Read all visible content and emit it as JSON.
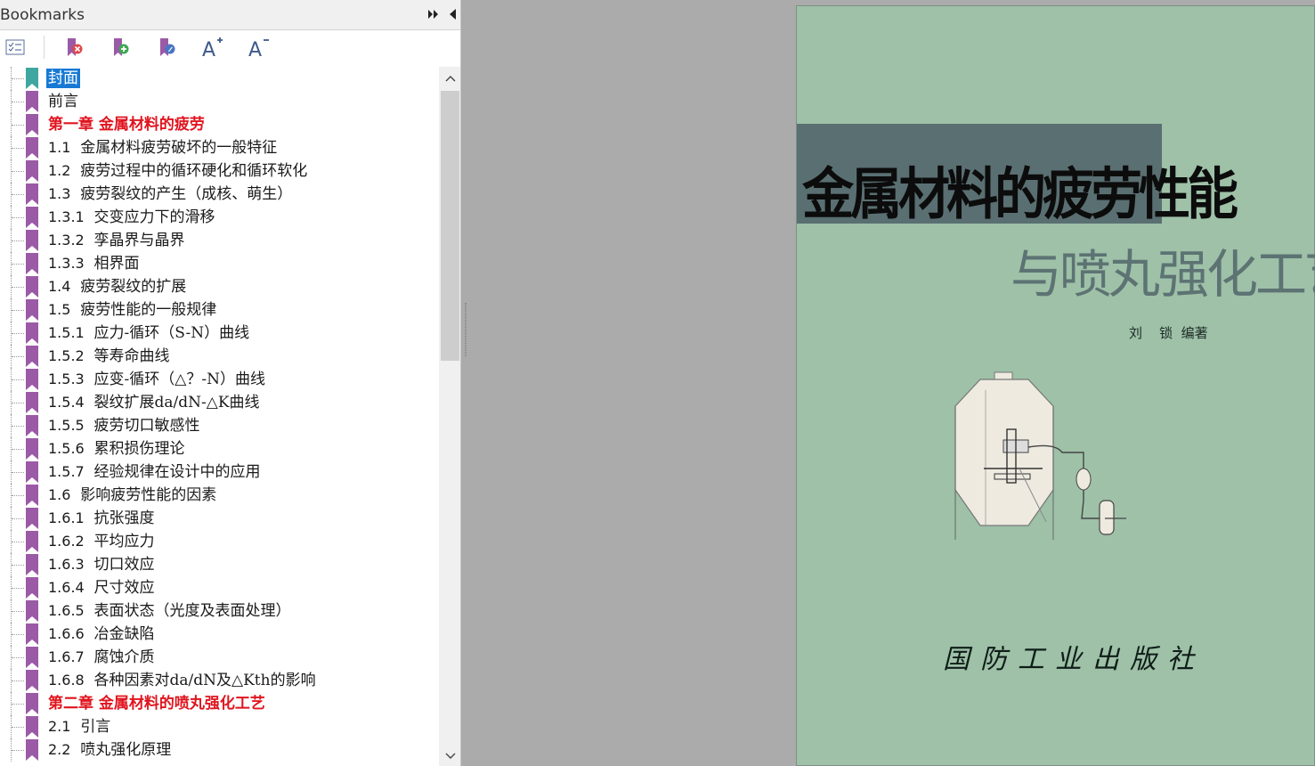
{
  "panel": {
    "title": "Bookmarks",
    "header_buttons": [
      "expand-icon",
      "collapse-panel-icon"
    ],
    "toolbar": [
      "bookmark-options-icon",
      "delete-bookmark-icon",
      "add-bookmark-icon",
      "bookmark-properties-icon",
      "increase-font-icon",
      "decrease-font-icon"
    ],
    "colors": {
      "bookmark_icon": "#9b5aa6",
      "bookmark_selected_icon": "#3fa6a0",
      "chapter_text": "#e0141e",
      "selection": "#1779d4"
    }
  },
  "bookmarks": [
    {
      "num": "",
      "text": "封面",
      "kind": "selected"
    },
    {
      "num": "",
      "text": "前言",
      "kind": "normal"
    },
    {
      "num": "",
      "text": "第一章  金属材料的疲劳",
      "kind": "chapter"
    },
    {
      "num": "1.1",
      "text": "金属材料疲劳破坏的一般特征",
      "kind": "normal"
    },
    {
      "num": "1.2",
      "text": "疲劳过程中的循环硬化和循环软化",
      "kind": "normal"
    },
    {
      "num": "1.3",
      "text": "疲劳裂纹的产生（成核、萌生）",
      "kind": "normal"
    },
    {
      "num": "1.3.1",
      "text": "交变应力下的滑移",
      "kind": "normal"
    },
    {
      "num": "1.3.2",
      "text": "孪晶界与晶界",
      "kind": "normal"
    },
    {
      "num": "1.3.3",
      "text": "相界面",
      "kind": "normal"
    },
    {
      "num": "1.4",
      "text": "疲劳裂纹的扩展",
      "kind": "normal"
    },
    {
      "num": "1.5",
      "text": "疲劳性能的一般规律",
      "kind": "normal"
    },
    {
      "num": "1.5.1",
      "text": "应力-循环（S-N）曲线",
      "kind": "normal"
    },
    {
      "num": "1.5.2",
      "text": "等寿命曲线",
      "kind": "normal"
    },
    {
      "num": "1.5.3",
      "text": "应变-循环（△？-N）曲线",
      "kind": "normal"
    },
    {
      "num": "1.5.4",
      "text": "裂纹扩展da/dN-△K曲线",
      "kind": "normal"
    },
    {
      "num": "1.5.5",
      "text": "疲劳切口敏感性",
      "kind": "normal"
    },
    {
      "num": "1.5.6",
      "text": "累积损伤理论",
      "kind": "normal"
    },
    {
      "num": "1.5.7",
      "text": "经验规律在设计中的应用",
      "kind": "normal"
    },
    {
      "num": "1.6",
      "text": "影响疲劳性能的因素",
      "kind": "normal"
    },
    {
      "num": "1.6.1",
      "text": "抗张强度",
      "kind": "normal"
    },
    {
      "num": "1.6.2",
      "text": "平均应力",
      "kind": "normal"
    },
    {
      "num": "1.6.3",
      "text": "切口效应",
      "kind": "normal"
    },
    {
      "num": "1.6.4",
      "text": "尺寸效应",
      "kind": "normal"
    },
    {
      "num": "1.6.5",
      "text": "表面状态（光度及表面处理）",
      "kind": "normal"
    },
    {
      "num": "1.6.6",
      "text": "冶金缺陷",
      "kind": "normal"
    },
    {
      "num": "1.6.7",
      "text": "腐蚀介质",
      "kind": "normal"
    },
    {
      "num": "1.6.8",
      "text": "各种因素对da/dN及△Kth的影响",
      "kind": "normal"
    },
    {
      "num": "",
      "text": "第二章  金属材料的喷丸强化工艺",
      "kind": "chapter"
    },
    {
      "num": "2.1",
      "text": "引言",
      "kind": "normal"
    },
    {
      "num": "2.2",
      "text": "喷丸强化原理",
      "kind": "normal"
    }
  ],
  "document": {
    "cover": {
      "title": "金属材料的疲劳性能",
      "subtitle": "与喷丸强化工艺",
      "author": "刘    锁  编著",
      "publisher": "国防工业出版社",
      "colors": {
        "background": "#9ec1a8",
        "title_band": "#5a6f72"
      }
    }
  }
}
